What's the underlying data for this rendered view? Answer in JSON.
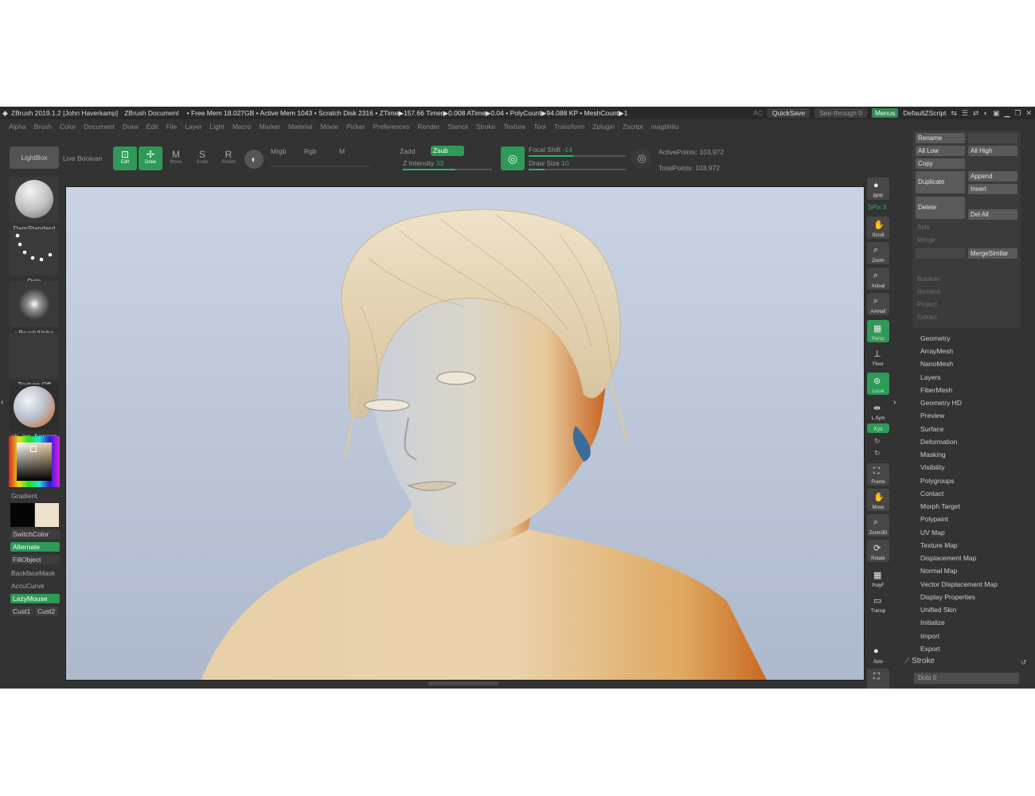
{
  "window": {
    "title": "ZBrush 2019.1.2 [John Haverkamp]",
    "document": "ZBrush Document",
    "stats": "• Free Mem 18.027GB • Active Mem 1043 • Scratch Disk 2316 • ZTime▶157.66 Timer▶0.008 ATime▶0.04 • PolyCount▶94.088 KP • MeshCount▶1",
    "ac": "AC",
    "quicksave": "QuickSave",
    "see_through": "See-through 0",
    "menus": "Menus",
    "default_script": "DefaultZScript"
  },
  "menubar": [
    "Alpha",
    "Brush",
    "Color",
    "Document",
    "Draw",
    "Edit",
    "File",
    "Layer",
    "Light",
    "Macro",
    "Marker",
    "Material",
    "Movie",
    "Picker",
    "Preferences",
    "Render",
    "Stencil",
    "Stroke",
    "Texture",
    "Tool",
    "Transform",
    "Zplugin",
    "Zscript",
    "magbhitu"
  ],
  "top_shelf": {
    "lightbox": "LightBox",
    "live_boolean": "Live Boolean",
    "edit": "Edit",
    "draw": "Draw",
    "move": "Move",
    "scale": "Scale",
    "rotate": "Rotate",
    "mrgb": "Mrgb",
    "rgb": "Rgb",
    "m": "M",
    "zadd": "Zadd",
    "zsub": "Zsub",
    "z_intensity_label": "Z Intensity",
    "z_intensity_value": "33",
    "focal_shift_label": "Focal Shift",
    "focal_shift_value": "-14",
    "draw_size_label": "Draw Size",
    "draw_size_value": "10",
    "active_points": "ActivePoints: 103,972",
    "total_points": "TotalPoints: 103,972"
  },
  "left_shelf": {
    "brush": "DamStandard",
    "stroke": "Dots",
    "alpha": "~BrushAlpha",
    "texture": "Texture Off",
    "material": "ok_ice_furnace",
    "gradient": "Gradient",
    "switch_color": "SwitchColor",
    "alternate": "Alternate",
    "fill_object": "FillObject",
    "backface_mask": "BackfaceMask",
    "accucurve": "AccuCurve",
    "lazymouse": "LazyMouse",
    "cust1": "Cust1",
    "cust2": "Cust2"
  },
  "right_shelf": {
    "spix": "SPix 3",
    "buttons": [
      "BPR",
      "Scroll",
      "Zoom",
      "Actual",
      "AAHalf",
      "Persp",
      "Floor",
      "Local",
      "L.Sym",
      "Xyz",
      "Frame",
      "Move",
      "Zoom3D",
      "Rotate",
      "PolyF",
      "Transp",
      "Solo"
    ]
  },
  "subtool_panel": {
    "rename": "Rename",
    "all_low": "All Low",
    "all_high": "All High",
    "copy": "Copy",
    "append": "Append",
    "duplicate": "Duplicate",
    "insert": "Insert",
    "delete": "Delete",
    "del_all": "Del All",
    "split": "Split",
    "merge": "Merge",
    "merge_similar": "MergeSimilar",
    "boolean": "Boolean",
    "remesh": "Remesh",
    "project": "Project",
    "extract": "Extract"
  },
  "tool_menu": [
    "Geometry",
    "ArrayMesh",
    "NanoMesh",
    "Layers",
    "FiberMesh",
    "Geometry HD",
    "Preview",
    "Surface",
    "Deformation",
    "Masking",
    "Visibility",
    "Polygroups",
    "Contact",
    "Morph Target",
    "Polypaint",
    "UV Map",
    "Texture Map",
    "Displacement Map",
    "Normal Map",
    "Vector Displacement Map",
    "Display Properties",
    "Unified Skin",
    "Initialize",
    "Import",
    "Export"
  ],
  "stroke_panel": {
    "title": "Stroke",
    "dots": "Dots 0"
  },
  "colors": {
    "accent_green": "#2d9a57",
    "ui_background": "#333333",
    "viewport_top": "#c9d3e3",
    "skin": "#e6d3b4"
  }
}
